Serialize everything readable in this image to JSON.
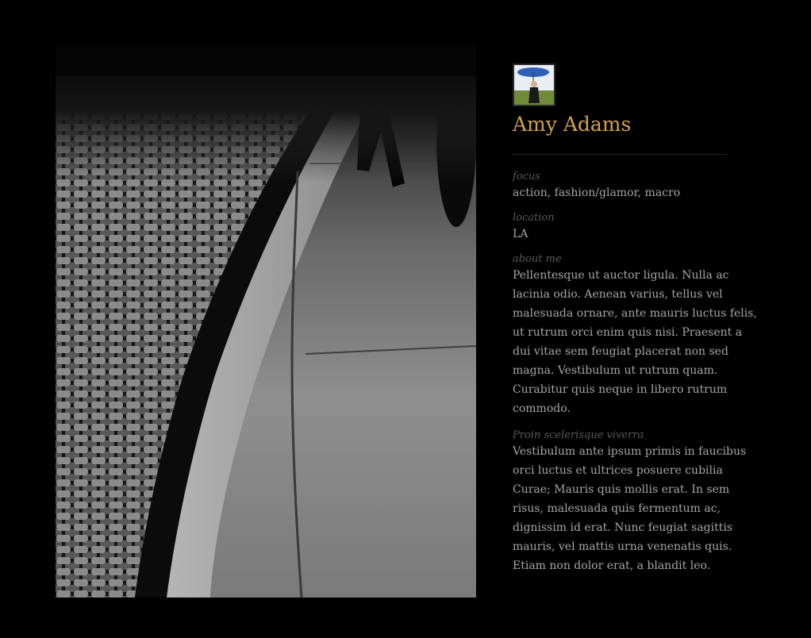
{
  "profile": {
    "name": "Amy Adams",
    "accent_color": "#d4a24a",
    "fields": [
      {
        "label": "focus",
        "value": "action, fashion/glamor, macro"
      },
      {
        "label": "location",
        "value": "LA"
      },
      {
        "label": "about me",
        "value": "Pellentesque ut auctor ligula. Nulla ac lacinia odio. Aenean varius, tellus vel malesuada ornare, ante mauris luctus felis, ut rutrum orci enim quis nisi. Praesent a dui vitae sem feugiat placerat non sed magna. Vestibulum ut rutrum quam. Curabitur quis neque in libero rutrum commodo."
      },
      {
        "label": "Proin scelerisque viverra",
        "value": "Vestibulum ante ipsum primis in faucibus orci luctus et ultrices posuere cubilia Curae; Mauris quis mollis erat. In sem risus, malesuada quis fermentum ac, dignissim id erat. Nunc feugiat sagittis mauris, vel mattis urna venenatis quis. Etiam non dolor erat, a blandit leo."
      }
    ]
  }
}
